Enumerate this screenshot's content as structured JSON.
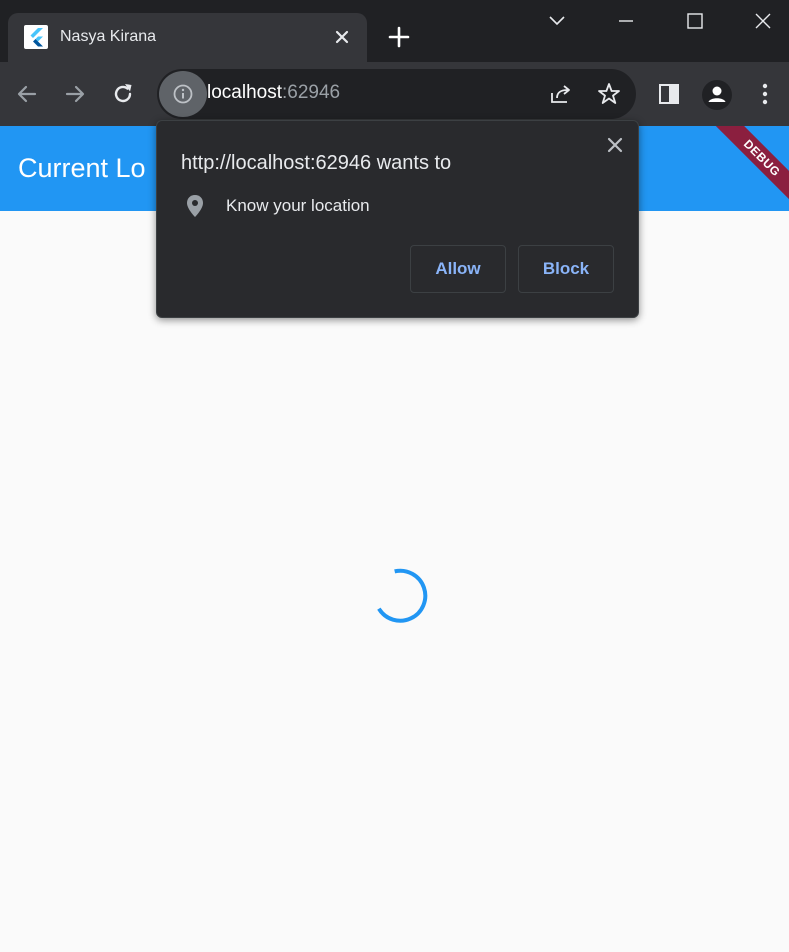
{
  "window": {
    "tab": {
      "title": "Nasya Kirana",
      "favicon": "flutter-logo-icon"
    },
    "controls": [
      "tab-search-icon",
      "minimize-icon",
      "maximize-icon",
      "close-icon"
    ]
  },
  "toolbar": {
    "url_host": "localhost",
    "url_port": ":62946",
    "icons": [
      "back-icon",
      "forward-icon",
      "reload-icon",
      "site-info-icon",
      "share-icon",
      "bookmark-star-icon",
      "side-panel-icon",
      "profile-icon",
      "menu-icon"
    ]
  },
  "app": {
    "title": "Current Lo",
    "debug_banner": "DEBUG",
    "colors": {
      "appbar": "#2196f3",
      "spinner": "#2196f3",
      "background": "#fafafa"
    }
  },
  "permission_popup": {
    "title": "http://localhost:62946 wants to",
    "request": "Know your location",
    "request_icon": "location-pin-icon",
    "allow_label": "Allow",
    "block_label": "Block",
    "colors": {
      "button_text": "#8ab4f8",
      "background": "#292a2d"
    }
  }
}
